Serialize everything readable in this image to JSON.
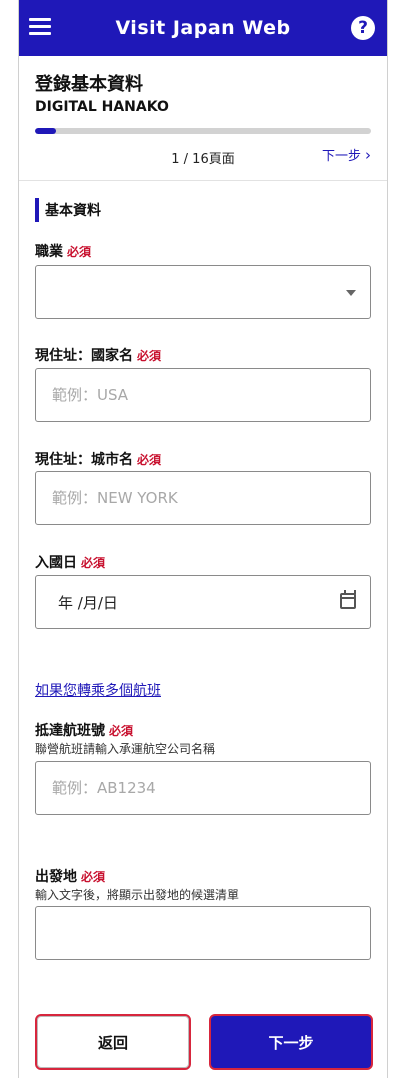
{
  "app": {
    "title": "Visit Japan Web",
    "help_label": "?"
  },
  "header": {
    "title": "登錄基本資料",
    "user": "DIGITAL HANAKO"
  },
  "progress": {
    "current": 1,
    "total": 16,
    "fraction": 0.0625,
    "label": "1 / 16頁面",
    "next_label": "下一步",
    "next_chevron": "›"
  },
  "section": {
    "title": "基本資料"
  },
  "required_label": "必須",
  "fields": {
    "occupation": {
      "label": "職業",
      "value": ""
    },
    "country": {
      "label": "現住址：國家名",
      "placeholder": "範例：USA"
    },
    "city": {
      "label": "現住址：城市名",
      "placeholder": "範例：NEW YORK"
    },
    "entry_date": {
      "label": "入國日",
      "display": "年 /月/日"
    },
    "flight": {
      "label": "抵達航班號",
      "hint": "聯營航班請輸入承運航空公司名稱",
      "placeholder": "範例：AB1234"
    },
    "departure": {
      "label": "出發地",
      "hint": "輸入文字後，將顯示出發地的候選清單",
      "placeholder": ""
    }
  },
  "multi_flight_link": "如果您轉乘多個航班",
  "buttons": {
    "back": "返回",
    "next": "下一步"
  },
  "colors": {
    "brand": "#1f18b8",
    "required": "#c8102e",
    "highlight": "#d7263d"
  }
}
